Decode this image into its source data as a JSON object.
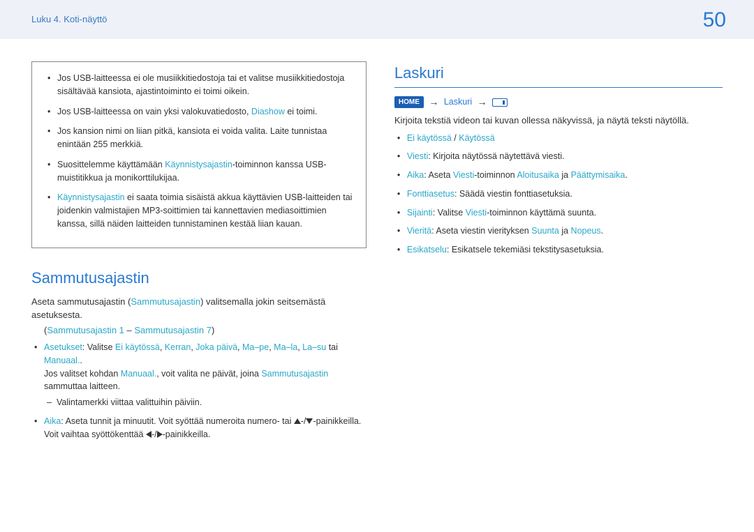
{
  "header": {
    "chapter": "Luku 4. Koti-näyttö",
    "page": "50"
  },
  "left": {
    "note": {
      "i0a": "Jos USB-laitteessa ei ole musiikkitiedostoja tai et valitse musiikkitiedostoja sisältävää kansiota, ajastintoiminto ei toimi oikein.",
      "i1a": "Jos USB-laitteessa on vain yksi valokuvatiedosto, ",
      "i1b": "Diashow",
      "i1c": " ei toimi.",
      "i2a": "Jos kansion nimi on liian pitkä, kansiota ei voida valita. Laite tunnistaa enintään 255 merkkiä.",
      "i3a": "Suosittelemme käyttämään ",
      "i3b": "Käynnistysajastin",
      "i3c": "-toiminnon kanssa USB-muistitikkua ja monikorttilukijaa.",
      "i4a": "Käynnistysajastin",
      "i4b": " ei saata toimia sisäistä akkua käyttävien USB-laitteiden tai joidenkin valmistajien MP3-soittimien tai kannettavien mediasoittimien kanssa, sillä näiden laitteiden tunnistaminen kestää liian kauan."
    },
    "shutdown": {
      "title": "Sammutusajastin",
      "intro_a": "Aseta sammutusajastin (",
      "intro_b": "Sammutusajastin",
      "intro_c": ") valitsemalla jokin seitsemästä asetuksesta.",
      "parens_a": "(",
      "parens_b": "Sammutusajastin 1",
      "parens_c": " – ",
      "parens_d": "Sammutusajastin 7",
      "parens_e": ")",
      "b0_label": "Asetukset",
      "b0_a": ": Valitse ",
      "b0_o0": "Ei käytössä",
      "b0_o1": "Kerran",
      "b0_o2": "Joka päivä",
      "b0_o3": "Ma–pe",
      "b0_o4": "Ma–la",
      "b0_o5": "La–su",
      "b0_or": " tai ",
      "b0_o6": "Manuaal.",
      "b0_tail": ".",
      "b0_line2a": "Jos valitset kohdan ",
      "b0_line2b": "Manuaal.",
      "b0_line2c": ", voit valita ne päivät, joina ",
      "b0_line2d": "Sammutusajastin",
      "b0_line2e": " sammuttaa laitteen.",
      "b0_dash": "Valintamerkki viittaa valittuihin päiviin.",
      "b1_label": "Aika",
      "b1_a": ": Aseta tunnit ja minuutit. Voit syöttää numeroita numero- tai ",
      "b1_b": "-/",
      "b1_c": "-painikkeilla. Voit vaihtaa syöttökenttää ",
      "b1_d": "-/",
      "b1_e": "-painikkeilla."
    }
  },
  "right": {
    "title": "Laskuri",
    "crumb_home": "HOME",
    "crumb_label": "Laskuri",
    "intro": "Kirjoita tekstiä videon tai kuvan ollessa näkyvissä, ja näytä teksti näytöllä.",
    "i0a": "Ei käytössä",
    "i0b": " / ",
    "i0c": "Käytössä",
    "i1_label": "Viesti",
    "i1_txt": ": Kirjoita näytössä näytettävä viesti.",
    "i2_label": "Aika",
    "i2_a": ": Aseta ",
    "i2_b": "Viesti",
    "i2_c": "-toiminnon ",
    "i2_d": "Aloitusaika",
    "i2_e": " ja ",
    "i2_f": "Päättymisaika",
    "i2_g": ".",
    "i3_label": "Fonttiasetus",
    "i3_txt": ": Säädä viestin fonttiasetuksia.",
    "i4_label": "Sijainti",
    "i4_a": ": Valitse ",
    "i4_b": "Viesti",
    "i4_c": "-toiminnon käyttämä suunta.",
    "i5_label": "Vieritä",
    "i5_a": ": Aseta viestin vierityksen ",
    "i5_b": "Suunta",
    "i5_c": " ja ",
    "i5_d": "Nopeus",
    "i5_e": ".",
    "i6_label": "Esikatselu",
    "i6_txt": ": Esikatsele tekemiäsi tekstitysasetuksia."
  },
  "sep": ", "
}
